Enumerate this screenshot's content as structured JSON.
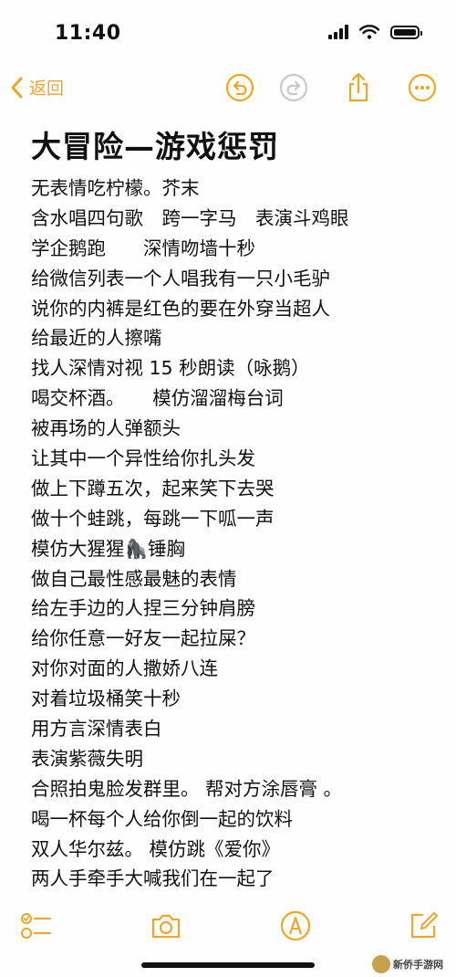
{
  "status": {
    "time": "11:40"
  },
  "nav": {
    "back_label": "返回"
  },
  "note": {
    "title": "大冒险—游戏惩罚",
    "lines": [
      "无表情吃柠檬。芥末",
      "含水唱四句歌　跨一字马　表演斗鸡眼",
      "学企鹅跑　　深情吻墙十秒",
      "给微信列表一个人唱我有一只小毛驴",
      "说你的内裤是红色的要在外穿当超人",
      "给最近的人擦嘴",
      "找人深情对视 15 秒朗读（咏鹅）",
      "喝交杯酒。　　模仿溜溜梅台词",
      "被再场的人弹额头",
      "让其中一个异性给你扎头发",
      "做上下蹲五次，起来笑下去哭",
      "做十个蛙跳，每跳一下呱一声",
      "模仿大猩猩🦍锤胸",
      "做自己最性感最魅的表情",
      "给左手边的人捏三分钟肩膀",
      "给你任意一好友一起拉屎？",
      "对你对面的人撒娇八连",
      "对着垃圾桶笑十秒",
      "用方言深情表白",
      "表演紫薇失明",
      "合照拍鬼脸发群里。 帮对方涂唇膏 。",
      "喝一杯每个人给你倒一起的饮料",
      "双人华尔兹。 模仿跳《爱你》",
      "两人手牵手大喊我们在一起了"
    ]
  },
  "watermark": {
    "text": "新侨手游网"
  },
  "colors": {
    "accent": "#e9a72b",
    "text": "#111111",
    "background": "#fefefe"
  },
  "icons": {
    "nav": [
      "back-chevron",
      "undo",
      "redo",
      "share",
      "more"
    ],
    "toolbar": [
      "checklist",
      "camera",
      "markup",
      "compose"
    ]
  }
}
